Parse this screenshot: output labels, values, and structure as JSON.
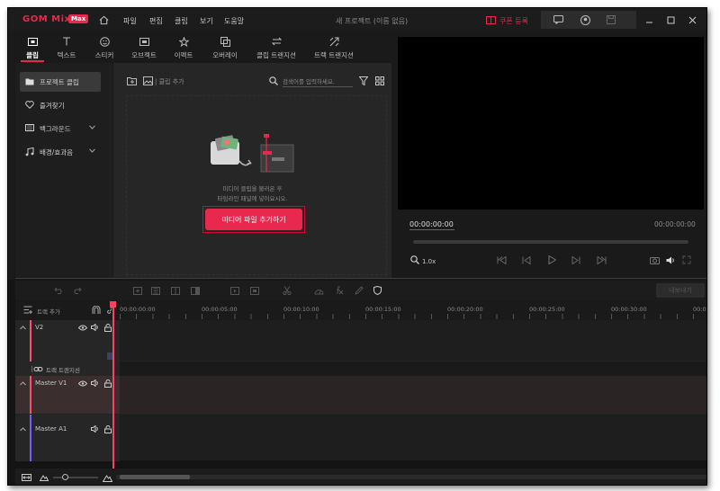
{
  "app": {
    "logo": "GOM Mix",
    "badge": "Max",
    "project_title": "새 프로젝트 (이름 없음)",
    "coupon": "쿠폰 등록"
  },
  "menu": [
    "파일",
    "편집",
    "클립",
    "보기",
    "도움말"
  ],
  "tabs": [
    {
      "label": "클립",
      "icon": "clip-icon"
    },
    {
      "label": "텍스트",
      "icon": "text-icon"
    },
    {
      "label": "스티커",
      "icon": "sticker-icon"
    },
    {
      "label": "오브젝트",
      "icon": "object-icon"
    },
    {
      "label": "이펙트",
      "icon": "effect-icon"
    },
    {
      "label": "오버레이",
      "icon": "overlay-icon"
    },
    {
      "label": "클립 트랜지션",
      "icon": "clip-transition-icon"
    },
    {
      "label": "트랙 트랜지션",
      "icon": "track-transition-icon"
    }
  ],
  "sidebar": {
    "items": [
      {
        "label": "프로젝트 클립"
      },
      {
        "label": "즐겨찾기"
      },
      {
        "label": "백그라운드"
      },
      {
        "label": "배경/효과음"
      }
    ]
  },
  "clips": {
    "add_clip": "| 클립 추가",
    "search_placeholder": "검색어를 입력하세요.",
    "empty_line1": "미디어 클립을 불러온 후",
    "empty_line2": "타임라인 패널에 넣어요시오.",
    "add_media_button": "미디어 파일 추가하기"
  },
  "preview": {
    "current_time": "00:00:00:00",
    "total_time": "00:00:00:00",
    "zoom": "1.0x"
  },
  "timeline": {
    "export_button": "내보내기",
    "add_track": "트랙 추가",
    "ruler": [
      "00:00:00:00",
      "00:00:05:00",
      "00:00:10:00",
      "00:00:15:00",
      "00:00:20:00",
      "00:00:25:00",
      "00:00:30:00",
      "00:00:35"
    ],
    "tracks": {
      "v2": "V2",
      "transition": "트랙 트랜지션",
      "v1": "Master V1",
      "a1": "Master A1"
    }
  },
  "colors": {
    "brand": "#e8284c",
    "accent_video": "#ff4f6b",
    "accent_audio": "#7a5cff"
  }
}
